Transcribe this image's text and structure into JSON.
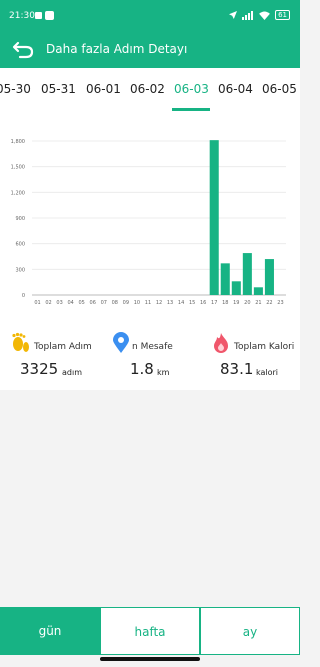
{
  "status_bar": {
    "time": "21:30",
    "battery": "61"
  },
  "header": {
    "title": "Daha fazla Adım Detayı"
  },
  "dates": [
    "05-30",
    "05-31",
    "06-01",
    "06-02",
    "06-03",
    "06-04",
    "06-05"
  ],
  "selected_date": "06-03",
  "chart_data": {
    "type": "bar",
    "categories": [
      "01",
      "02",
      "03",
      "04",
      "05",
      "06",
      "07",
      "08",
      "09",
      "10",
      "11",
      "12",
      "13",
      "14",
      "15",
      "16",
      "17",
      "18",
      "19",
      "20",
      "21",
      "22",
      "23"
    ],
    "values": [
      0,
      0,
      0,
      0,
      0,
      0,
      0,
      0,
      0,
      0,
      0,
      0,
      0,
      0,
      0,
      0,
      1810,
      370,
      160,
      490,
      90,
      420,
      0
    ],
    "yticks": [
      "0",
      "300",
      "600",
      "900",
      "1,200",
      "1,500",
      "1,800"
    ],
    "ylim": [
      0,
      1800
    ],
    "grid": true,
    "color": "#17b384"
  },
  "stats": {
    "steps": {
      "label": "Toplam Adım",
      "value": "3325",
      "unit": "adım"
    },
    "distance": {
      "label": "n Mesafe",
      "value": "1.8",
      "unit": "km"
    },
    "calories": {
      "label": "Toplam Kalori",
      "value": "83.1",
      "unit": "kalori"
    }
  },
  "tabs": {
    "day": "gün",
    "week": "hafta",
    "month": "ay"
  },
  "colors": {
    "accent": "#17b384"
  }
}
